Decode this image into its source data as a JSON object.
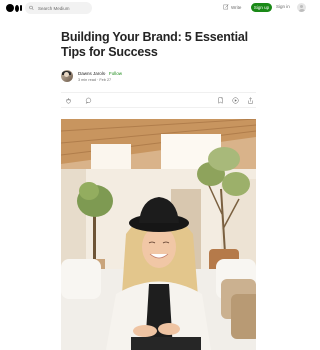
{
  "header": {
    "search_placeholder": "Search Medium",
    "write_label": "Write",
    "signup_label": "Sign up",
    "signin_label": "Sign in"
  },
  "article": {
    "title": "Building Your Brand: 5 Essential Tips for Success",
    "author": "Dawns Jarols",
    "follow_label": "Follow",
    "read_time": "3 min read",
    "date": "Feb 27",
    "separator": "·"
  },
  "icons": [
    "medium-logo-icon",
    "search-icon",
    "write-icon",
    "avatar-icon",
    "clap-icon",
    "comment-icon",
    "bookmark-icon",
    "play-icon",
    "share-icon"
  ],
  "colors": {
    "accent_green": "#1a8917",
    "text": "#242424",
    "muted": "#6b6b6b"
  }
}
